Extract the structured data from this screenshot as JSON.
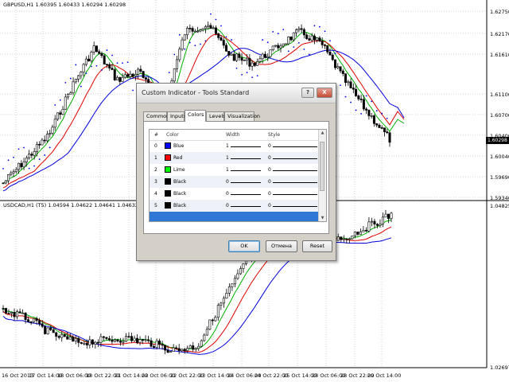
{
  "top_chart": {
    "header": "GBPUSD,H1  1.60395 1.60433 1.60294 1.60298",
    "price_labels": [
      "1.62750",
      "1.62170",
      "1.61610",
      "1.61100",
      "1.60700",
      "1.60400",
      "1.60040",
      "1.59690",
      "1.59340"
    ],
    "current_price": "1.60298"
  },
  "bottom_chart": {
    "header": "USDCAD,H1 (T5) 1.04594 1.04622 1.04641 1.04632 1.04658 1.04631 1.04",
    "price_labels": [
      "1.04825",
      "1.02697"
    ]
  },
  "time_axis": [
    "16 Oct 2013",
    "17 Oct 14:00",
    "18 Oct 06:00",
    "18 Oct 22:00",
    "21 Oct 14:00",
    "22 Oct 06:00",
    "22 Oct 22:00",
    "23 Oct 14:00",
    "24 Oct 06:00",
    "24 Oct 22:00",
    "25 Oct 14:00",
    "28 Oct 06:00",
    "28 Oct 22:00",
    "29 Oct 14:00"
  ],
  "colors": {
    "bull": "#00a000",
    "bear": "#c00000",
    "ma_red": "#e00000",
    "ma_green": "#00b000",
    "ma_blue": "#0000dd",
    "psar": "#0000ee"
  },
  "dialog": {
    "title": "Custom Indicator - Tools Standard",
    "help_label": "?",
    "close_label": "X",
    "tabs": [
      "Common",
      "Inputs",
      "Colors",
      "Levels",
      "Visualization"
    ],
    "active_tab": "Colors",
    "table": {
      "headers": [
        "#",
        "Color",
        "Width",
        "Style"
      ],
      "rows": [
        {
          "index": "0",
          "color_name": "Blue",
          "swatch": "#0000ff",
          "width": "1",
          "style": "0"
        },
        {
          "index": "1",
          "color_name": "Red",
          "swatch": "#ff0000",
          "width": "1",
          "style": "0"
        },
        {
          "index": "2",
          "color_name": "Lime",
          "swatch": "#00ff00",
          "width": "1",
          "style": "0"
        },
        {
          "index": "3",
          "color_name": "Black",
          "swatch": "#000000",
          "width": "0",
          "style": "0"
        },
        {
          "index": "4",
          "color_name": "Black",
          "swatch": "#000000",
          "width": "0",
          "style": "0"
        },
        {
          "index": "5",
          "color_name": "Black",
          "swatch": "#000000",
          "width": "0",
          "style": "0"
        }
      ]
    },
    "buttons": {
      "ok": "OK",
      "cancel": "Отмена",
      "reset": "Reset"
    }
  }
}
